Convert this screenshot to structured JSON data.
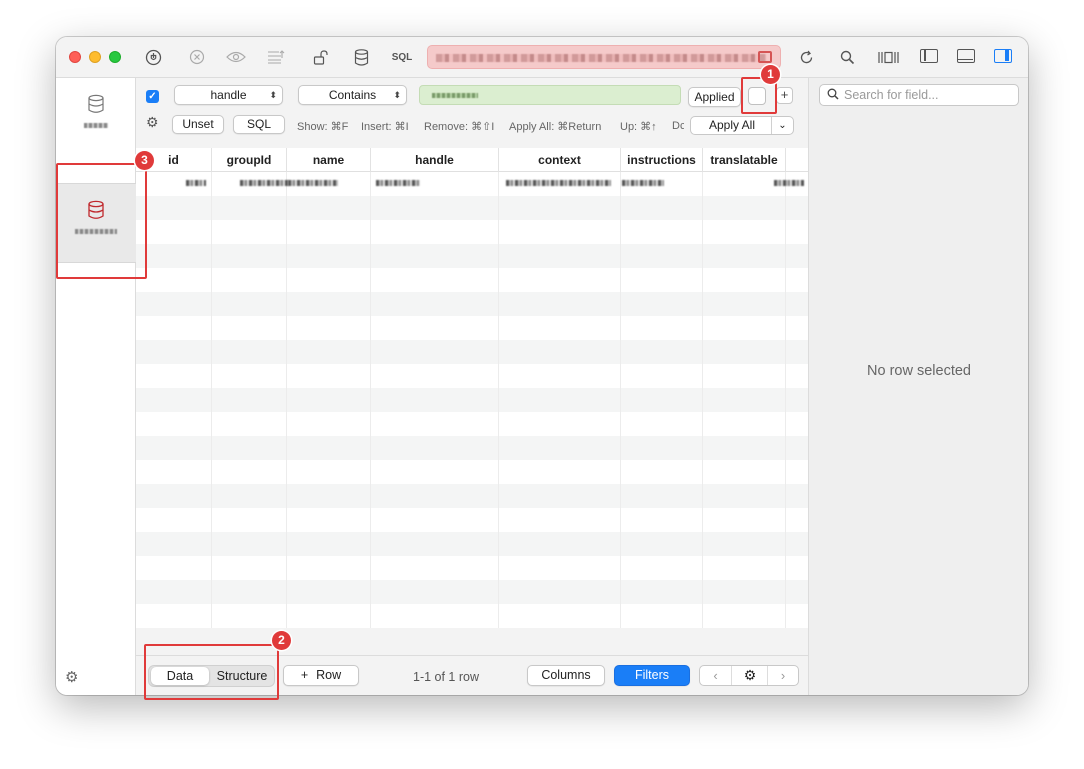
{
  "toolbar": {
    "sql_label": "SQL",
    "icons": [
      "plug-icon",
      "close-circle-icon",
      "eye-icon",
      "list-icon",
      "unlock-icon",
      "database-icon",
      "refresh-icon",
      "search-icon",
      "columns-icon",
      "left-sidebar-icon",
      "bottom-panel-icon",
      "right-sidebar-icon"
    ]
  },
  "filter": {
    "field": "handle",
    "operator": "Contains",
    "applied_label": "Applied",
    "add_label": "+",
    "unset_label": "Unset",
    "sql_label": "SQL",
    "hints": [
      "Show: ⌘F",
      "Insert: ⌘I",
      "Remove: ⌘⇧I",
      "Apply All: ⌘Return",
      "Up: ⌘↑",
      "Dc"
    ],
    "apply_all_label": "Apply All"
  },
  "table": {
    "columns": [
      "id",
      "groupId",
      "name",
      "handle",
      "context",
      "instructions",
      "translatable"
    ],
    "row_count": 19
  },
  "bottom": {
    "data_tab": "Data",
    "structure_tab": "Structure",
    "add_row": "Row",
    "row_count_text": "1-1 of 1 row",
    "columns_btn": "Columns",
    "filters_btn": "Filters"
  },
  "right_panel": {
    "search_placeholder": "Search for field...",
    "empty_text": "No row selected"
  },
  "annotations": [
    "1",
    "2",
    "3"
  ],
  "colors": {
    "accent": "#1a7ef7",
    "annotation": "#e03a3a",
    "filter_value_bg": "#dbeed0",
    "url_bar_bg": "#f5caca"
  }
}
